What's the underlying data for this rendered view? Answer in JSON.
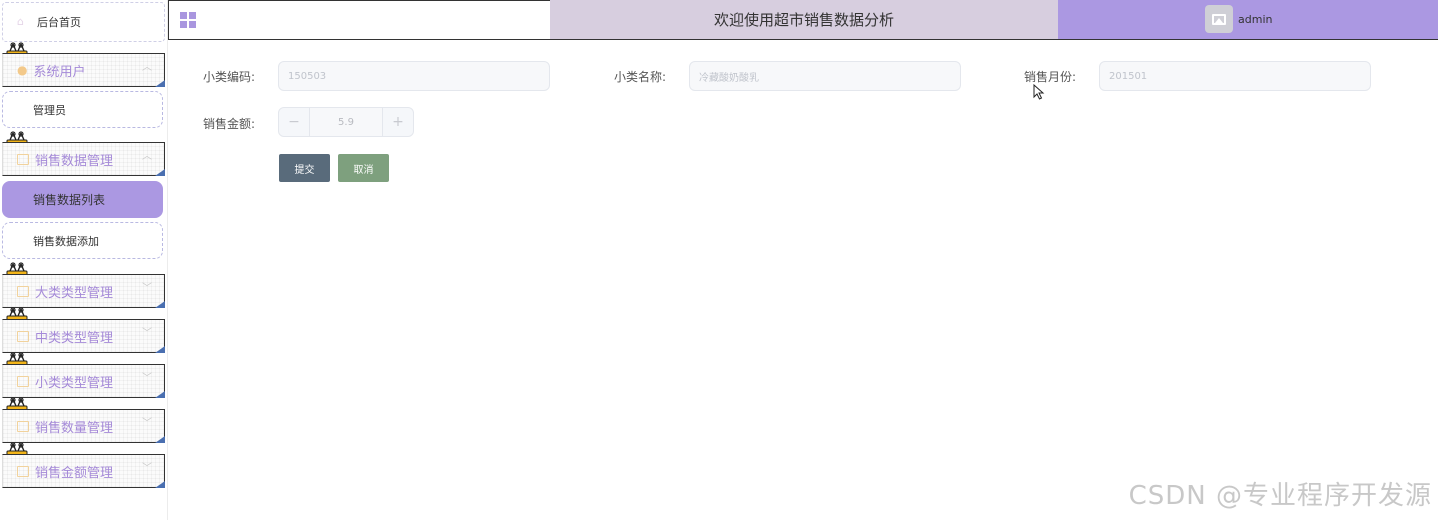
{
  "sidebar": {
    "home": {
      "label": "后台首页",
      "icon": "home-icon"
    },
    "groups": [
      {
        "label": "系统用户",
        "icon": "user-icon",
        "items": [
          {
            "label": "管理员"
          }
        ]
      },
      {
        "label": "销售数据管理",
        "icon": "folder-icon",
        "items": [
          {
            "label": "销售数据列表",
            "active": true
          },
          {
            "label": "销售数据添加"
          }
        ]
      },
      {
        "label": "大类类型管理",
        "icon": "folder-icon"
      },
      {
        "label": "中类类型管理",
        "icon": "folder-icon"
      },
      {
        "label": "小类类型管理",
        "icon": "folder-icon"
      },
      {
        "label": "销售数量管理",
        "icon": "folder-icon"
      },
      {
        "label": "销售金额管理",
        "icon": "folder-icon"
      }
    ]
  },
  "header": {
    "title": "欢迎使用超市销售数据分析",
    "username": "admin",
    "menu_icon": "grid-icon"
  },
  "form": {
    "subcategory_code": {
      "label": "小类编码:",
      "value": "150503"
    },
    "subcategory_name": {
      "label": "小类名称:",
      "value": "冷藏酸奶酸乳"
    },
    "sales_month": {
      "label": "销售月份:",
      "value": "201501"
    },
    "sales_amount": {
      "label": "销售金额:",
      "value": "5.9",
      "minus": "−",
      "plus": "+"
    },
    "submit_label": "提交",
    "cancel_label": "取消"
  },
  "watermark": "CSDN @专业程序开发源",
  "colors": {
    "accent": "#ab98e2",
    "title_bg": "#d7cedf",
    "submit": "#596b7b",
    "cancel": "#7ea07e"
  }
}
